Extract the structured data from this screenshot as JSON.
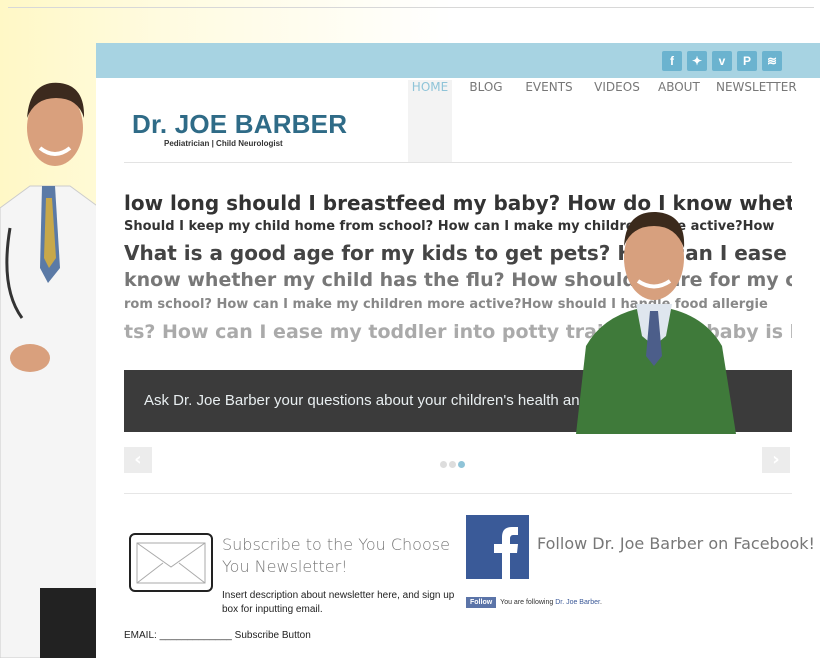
{
  "social": {
    "icons": [
      {
        "name": "facebook-icon",
        "glyph": "f"
      },
      {
        "name": "twitter-icon",
        "glyph": "✦"
      },
      {
        "name": "vimeo-icon",
        "glyph": "v"
      },
      {
        "name": "pinterest-icon",
        "glyph": "P"
      },
      {
        "name": "rss-icon",
        "glyph": "☰"
      }
    ]
  },
  "logo": {
    "name": "Dr. JOE BARBER",
    "subtitle": "Pediatrician | Child Neurologist"
  },
  "nav": {
    "items": [
      "HOME",
      "BLOG",
      "EVENTS",
      "VIDEOS",
      "ABOUT",
      "NEWSLETTER"
    ]
  },
  "slider": {
    "questions": [
      "low long should I breastfeed my baby?  How do I know whether my chil",
      "Should I keep my child home from school?  How can I make my children more active?How",
      "Vhat is a good age for my kids to get pets?  How can I ease my toddler in",
      " know whether my child has the flu?   How should I care for my child wh",
      "rom school?  How can I make my children more active?How should I handle food allergie",
      "ts? How can I ease my toddler into potty training?  My baby is bec"
    ],
    "caption": "Ask Dr. Joe Barber your questions about your children's health and wellness!",
    "prev": "‹",
    "next": "›"
  },
  "newsletter": {
    "title": "Subscribe to the You Choose You Newsletter!",
    "description": "Insert description about newsletter here, and sign up box for inputting email.",
    "email_row": "EMAIL: _____________ Subscribe Button"
  },
  "facebook": {
    "title": "Follow Dr. Joe Barber on Facebook!",
    "button": "Follow",
    "following_text": "You are following ",
    "following_name": "Dr. Joe Barber",
    "following_end": "."
  }
}
